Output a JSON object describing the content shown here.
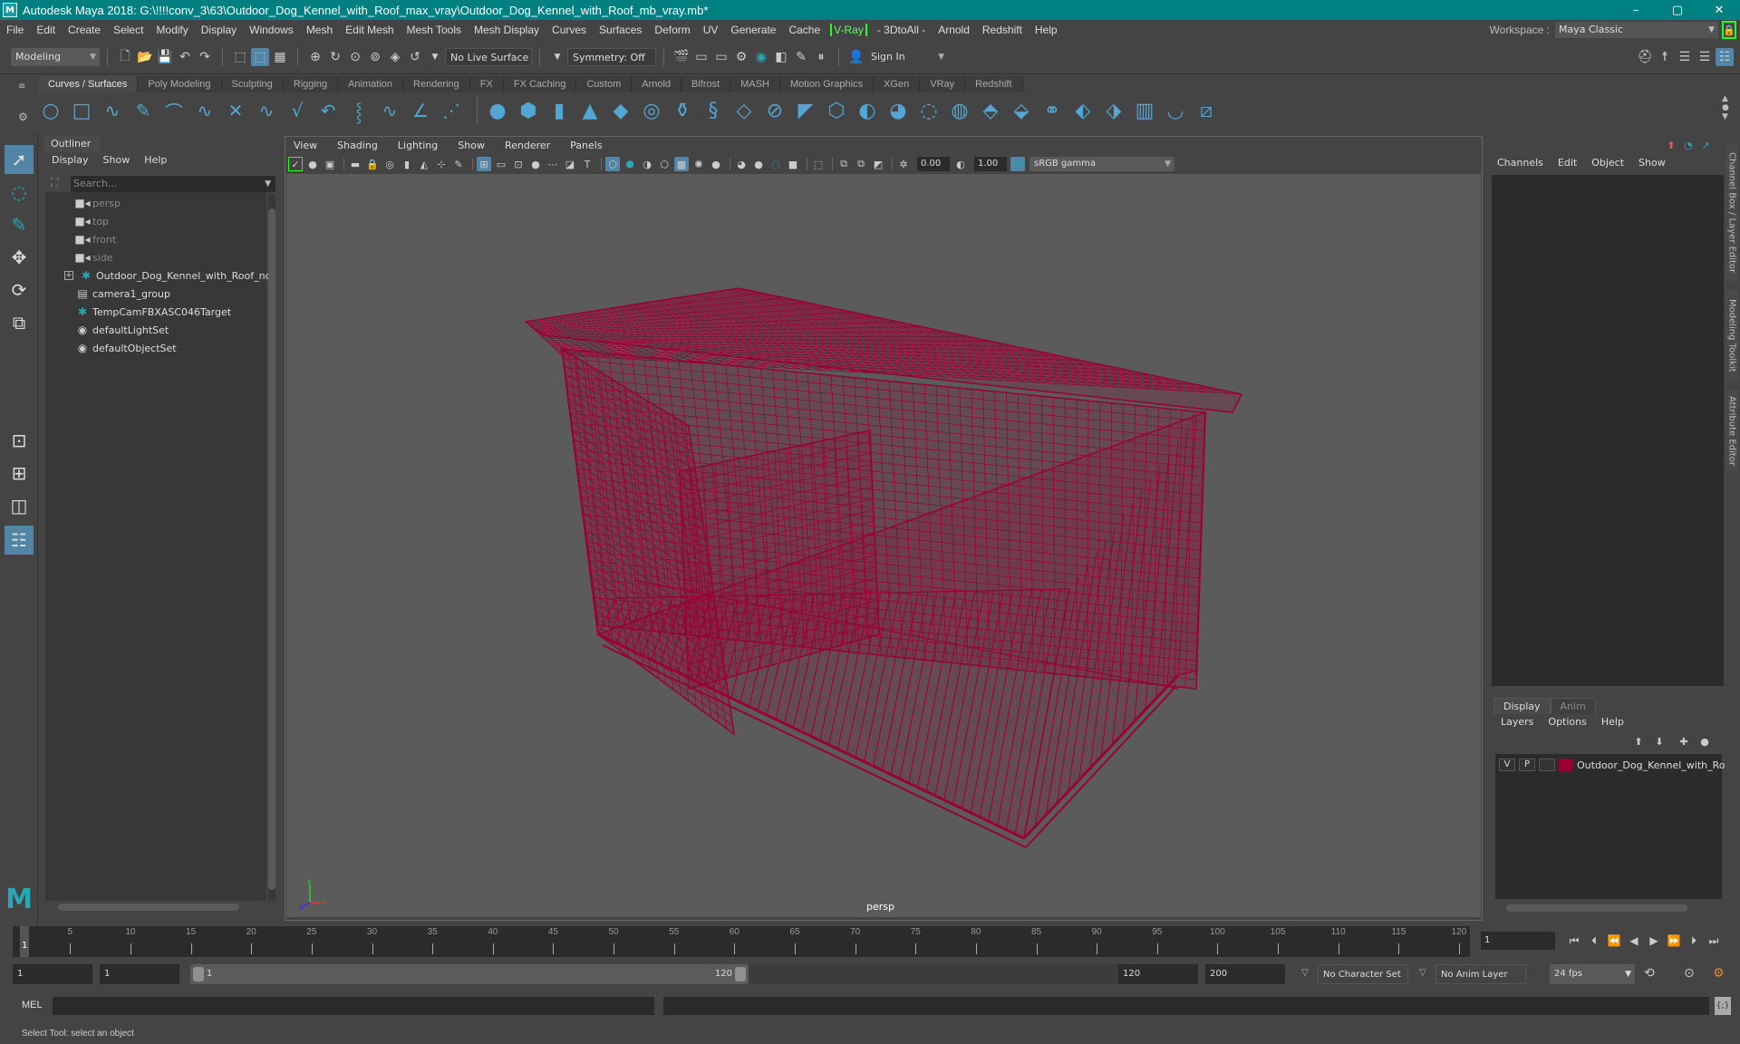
{
  "window": {
    "title": "Autodesk Maya 2018: G:\\!!!!conv_3\\63\\Outdoor_Dog_Kennel_with_Roof_max_vray\\Outdoor_Dog_Kennel_with_Roof_mb_vray.mb*",
    "logo": "M",
    "controls": {
      "minimize": "–",
      "maximize": "▢",
      "close": "✕"
    }
  },
  "menubar": {
    "items": [
      "File",
      "Edit",
      "Create",
      "Select",
      "Modify",
      "Display",
      "Windows",
      "Mesh",
      "Edit Mesh",
      "Mesh Tools",
      "Mesh Display",
      "Curves",
      "Surfaces",
      "Deform",
      "UV",
      "Generate",
      "Cache",
      "V-Ray",
      "- 3DtoAll -",
      "Arnold",
      "Redshift",
      "Help"
    ],
    "workspace_label": "Workspace :",
    "workspace_value": "Maya Classic"
  },
  "statusline": {
    "mode": "Modeling",
    "live_surface": "No Live Surface",
    "symmetry": "Symmetry: Off",
    "sign_in": "Sign In"
  },
  "shelf": {
    "tabs": [
      "Curves / Surfaces",
      "Poly Modeling",
      "Sculpting",
      "Rigging",
      "Animation",
      "Rendering",
      "FX",
      "FX Caching",
      "Custom",
      "Arnold",
      "Bifrost",
      "MASH",
      "Motion Graphics",
      "XGen",
      "VRay",
      "Redshift"
    ],
    "active_tab": "Curves / Surfaces"
  },
  "outliner": {
    "title": "Outliner",
    "menu": [
      "Display",
      "Show",
      "Help"
    ],
    "search_placeholder": "Search...",
    "items": [
      {
        "label": "persp",
        "icon": "camera-icon",
        "dim": true
      },
      {
        "label": "top",
        "icon": "camera-icon",
        "dim": true
      },
      {
        "label": "front",
        "icon": "camera-icon",
        "dim": true
      },
      {
        "label": "side",
        "icon": "camera-icon",
        "dim": true
      },
      {
        "label": "Outdoor_Dog_Kennel_with_Roof_ncl",
        "icon": "locator-icon",
        "dim": false,
        "expandable": true
      },
      {
        "label": "camera1_group",
        "icon": "group-icon",
        "dim": false
      },
      {
        "label": "TempCamFBXASC046Target",
        "icon": "locator-icon",
        "dim": false
      },
      {
        "label": "defaultLightSet",
        "icon": "set-icon",
        "dim": false
      },
      {
        "label": "defaultObjectSet",
        "icon": "set-icon",
        "dim": false
      }
    ]
  },
  "viewport": {
    "menu": [
      "View",
      "Shading",
      "Lighting",
      "Show",
      "Renderer",
      "Panels"
    ],
    "exposure": "0.00",
    "gamma": "1.00",
    "color_space": "sRGB gamma",
    "camera_label": "persp",
    "wireframe_color": "#990033",
    "axis": {
      "x": "x",
      "y": "y",
      "z": "z"
    }
  },
  "channelbox": {
    "menu": [
      "Channels",
      "Edit",
      "Object",
      "Show"
    ],
    "side_tabs": [
      "Channel Box / Layer Editor",
      "Modeling Toolkit",
      "Attribute Editor"
    ]
  },
  "layer_editor": {
    "tabs": [
      "Display",
      "Anim"
    ],
    "active_tab": "Display",
    "menu": [
      "Layers",
      "Options",
      "Help"
    ],
    "layers": [
      {
        "v": "V",
        "p": "P",
        "color": "#990033",
        "name": "Outdoor_Dog_Kennel_with_Ro"
      }
    ]
  },
  "timeline": {
    "ticks": [
      5,
      10,
      15,
      20,
      25,
      30,
      35,
      40,
      45,
      50,
      55,
      60,
      65,
      70,
      75,
      80,
      85,
      90,
      95,
      100,
      105,
      110,
      115,
      120
    ],
    "range_min": 1,
    "range_max": 120,
    "current_frame": "1",
    "current_frame_field": "1"
  },
  "range": {
    "start_frame": "1",
    "playback_start": "1",
    "slider_start": "1",
    "slider_end": "120",
    "playback_end": "120",
    "end_frame": "200",
    "character_set": "No Character Set",
    "anim_layer": "No Anim Layer",
    "fps": "24 fps"
  },
  "commandline": {
    "label": "MEL"
  },
  "helpline": {
    "text": "Select Tool: select an object"
  }
}
